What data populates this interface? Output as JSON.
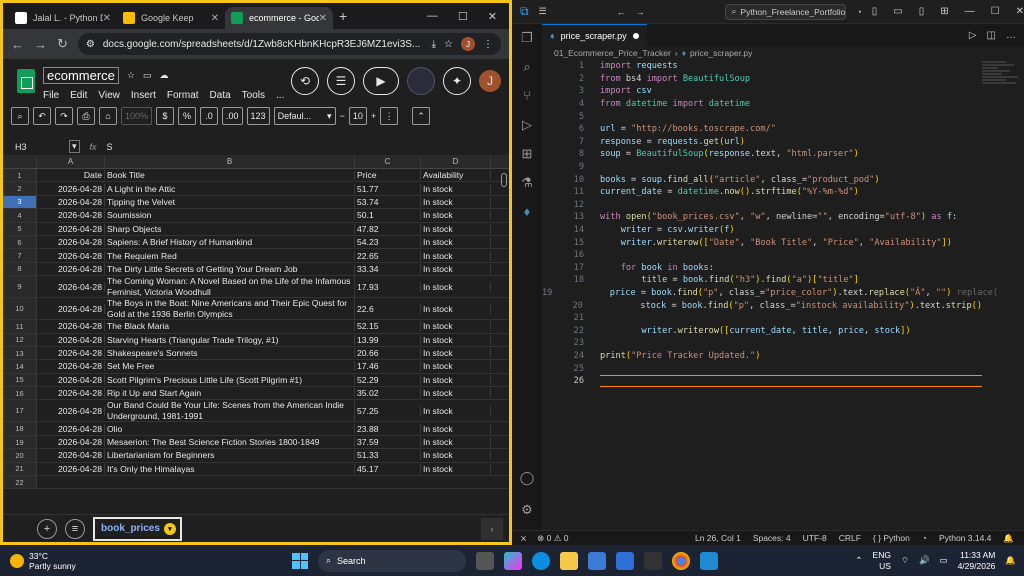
{
  "browser": {
    "tabs": [
      {
        "label": "Jalal L. - Python D",
        "icon_color": "#ffffff",
        "icon": "upwork-icon"
      },
      {
        "label": "Google Keep",
        "icon_color": "#fbbc04",
        "icon": "keep-icon"
      },
      {
        "label": "ecommerce - Goo",
        "icon_color": "#0f9d58",
        "icon": "sheets-icon"
      }
    ],
    "url": "docs.google.com/spreadsheets/d/1Zwb8cKHbnKHcpR3EJ6MZ1evi3S...",
    "avatar_letter": "J"
  },
  "sheets": {
    "doc_title": "ecommerce",
    "menus": [
      "File",
      "Edit",
      "View",
      "Insert",
      "Format",
      "Data",
      "Tools"
    ],
    "menu_more": "...",
    "zoom": "100%",
    "currency": "$",
    "percent": "%",
    "dec_less": ".0",
    "dec_more": ".00",
    "num_format": "123",
    "font": "Defaul...",
    "font_size": "10",
    "cell_ref": "H3",
    "formula_value": "S",
    "avatar_letter": "J",
    "columns": [
      "A",
      "B",
      "C",
      "D"
    ],
    "rows": [
      {
        "n": "1",
        "a": "Date",
        "b": "Book Title",
        "c": "Price",
        "d": "Availability",
        "header": true
      },
      {
        "n": "2",
        "a": "2026-04-28",
        "b": "A Light in the Attic",
        "c": "51.77",
        "d": "In stock"
      },
      {
        "n": "3",
        "a": "2026-04-28",
        "b": "Tipping the Velvet",
        "c": "53.74",
        "d": "In stock",
        "selected": true
      },
      {
        "n": "4",
        "a": "2026-04-28",
        "b": "Soumission",
        "c": "50.1",
        "d": "In stock"
      },
      {
        "n": "5",
        "a": "2026-04-28",
        "b": "Sharp Objects",
        "c": "47.82",
        "d": "In stock"
      },
      {
        "n": "6",
        "a": "2026-04-28",
        "b": "Sapiens: A Brief History of Humankind",
        "c": "54.23",
        "d": "In stock"
      },
      {
        "n": "7",
        "a": "2026-04-28",
        "b": "The Requiem Red",
        "c": "22.65",
        "d": "In stock"
      },
      {
        "n": "8",
        "a": "2026-04-28",
        "b": "The Dirty Little Secrets of Getting Your Dream Job",
        "c": "33.34",
        "d": "In stock"
      },
      {
        "n": "9",
        "a": "2026-04-28",
        "b": "The Coming Woman: A Novel Based on the Life of the Infamous Feminist, Victoria Woodhull",
        "c": "17.93",
        "d": "In stock",
        "tall": true
      },
      {
        "n": "10",
        "a": "2026-04-28",
        "b": "The Boys in the Boat: Nine Americans and Their Epic Quest for Gold at the 1936 Berlin Olympics",
        "c": "22.6",
        "d": "In stock",
        "tall": true
      },
      {
        "n": "11",
        "a": "2026-04-28",
        "b": "The Black Maria",
        "c": "52.15",
        "d": "In stock"
      },
      {
        "n": "12",
        "a": "2026-04-28",
        "b": "Starving Hearts (Triangular Trade Trilogy, #1)",
        "c": "13.99",
        "d": "In stock"
      },
      {
        "n": "13",
        "a": "2026-04-28",
        "b": "Shakespeare's Sonnets",
        "c": "20.66",
        "d": "In stock"
      },
      {
        "n": "14",
        "a": "2026-04-28",
        "b": "Set Me Free",
        "c": "17.46",
        "d": "In stock"
      },
      {
        "n": "15",
        "a": "2026-04-28",
        "b": "Scott Pilgrim's Precious Little Life (Scott Pilgrim #1)",
        "c": "52.29",
        "d": "In stock"
      },
      {
        "n": "16",
        "a": "2026-04-28",
        "b": "Rip it Up and Start Again",
        "c": "35.02",
        "d": "In stock"
      },
      {
        "n": "17",
        "a": "2026-04-28",
        "b": "Our Band Could Be Your Life: Scenes from the American Indie Underground, 1981-1991",
        "c": "57.25",
        "d": "In stock",
        "tall": true
      },
      {
        "n": "18",
        "a": "2026-04-28",
        "b": "Olio",
        "c": "23.88",
        "d": "In stock"
      },
      {
        "n": "19",
        "a": "2026-04-28",
        "b": "Mesaerion: The Best Science Fiction Stories 1800-1849",
        "c": "37.59",
        "d": "In stock"
      },
      {
        "n": "20",
        "a": "2026-04-28",
        "b": "Libertarianism for Beginners",
        "c": "51.33",
        "d": "In stock"
      },
      {
        "n": "21",
        "a": "2026-04-28",
        "b": "It's Only the Himalayas",
        "c": "45.17",
        "d": "In stock"
      },
      {
        "n": "22",
        "a": "",
        "b": "",
        "c": "",
        "d": ""
      }
    ],
    "sheet_tab": "book_prices"
  },
  "vscode": {
    "search": "Python_Freelance_Portfolio",
    "tab": "price_scraper.py",
    "breadcrumb": [
      "01_Ecommerce_Price_Tracker",
      "price_scraper.py"
    ],
    "code_lines": [
      "import requests",
      "from bs4 import BeautifulSoup",
      "import csv",
      "from datetime import datetime",
      "",
      "url = \"http://books.toscrape.com/\"",
      "response = requests.get(url)",
      "soup = BeautifulSoup(response.text, \"html.parser\")",
      "",
      "books = soup.find_all(\"article\", class_=\"product_pod\")",
      "current_date = datetime.now().strftime(\"%Y-%m-%d\")",
      "",
      "with open(\"book_prices.csv\", \"w\", newline=\"\", encoding=\"utf-8\") as f:",
      "    writer = csv.writer(f)",
      "    writer.writerow([\"Date\", \"Book Title\", \"Price\", \"Availability\"])",
      "",
      "    for book in books:",
      "        title = book.find(\"h3\").find(\"a\")[\"title\"]",
      "        price = book.find(\"p\", class_=\"price_color\").text.replace(\"Â\", \"\")",
      "        stock = book.find(\"p\", class_=\"instock availability\").text.strip()",
      "",
      "        writer.writerow([current_date, title, price, stock])",
      "",
      "print(\"Price Tracker Updated.\")",
      "",
      ""
    ],
    "ghost_text": "replace(",
    "status": {
      "errors": "0",
      "warnings": "0",
      "position": "Ln 26, Col 1",
      "spaces": "Spaces: 4",
      "encoding": "UTF-8",
      "eol": "CRLF",
      "language": "Python",
      "interpreter": "Python 3.14.4"
    }
  },
  "taskbar": {
    "temp": "33°C",
    "weather": "Partly sunny",
    "search": "Search",
    "lang": "ENG",
    "region": "US",
    "time": "11:33 AM",
    "date": "4/29/2026"
  }
}
